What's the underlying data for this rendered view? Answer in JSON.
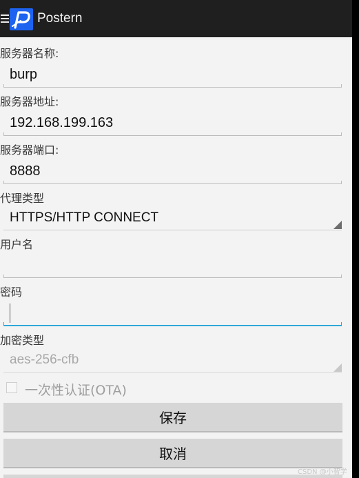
{
  "app": {
    "title": "Postern"
  },
  "form": {
    "server_name_label": "服务器名称:",
    "server_name_value": "burp",
    "server_address_label": "服务器地址:",
    "server_address_value": "192.168.199.163",
    "server_port_label": "服务器端口:",
    "server_port_value": "8888",
    "proxy_type_label": "代理类型",
    "proxy_type_value": "HTTPS/HTTP CONNECT",
    "username_label": "用户名",
    "username_value": "",
    "password_label": "密码",
    "password_value": "",
    "encryption_label": "加密类型",
    "encryption_value": "aes-256-cfb",
    "ota_label": "一次性认证(OTA)",
    "ota_checked": false
  },
  "buttons": {
    "save": "保存",
    "cancel": "取消"
  },
  "watermark": "CSDN @小智学安全",
  "colors": {
    "app_bar": "#1f1f1f",
    "logo": "#1d63f0",
    "focus_underline": "#2fa8d8",
    "button": "#d6d6d6"
  }
}
